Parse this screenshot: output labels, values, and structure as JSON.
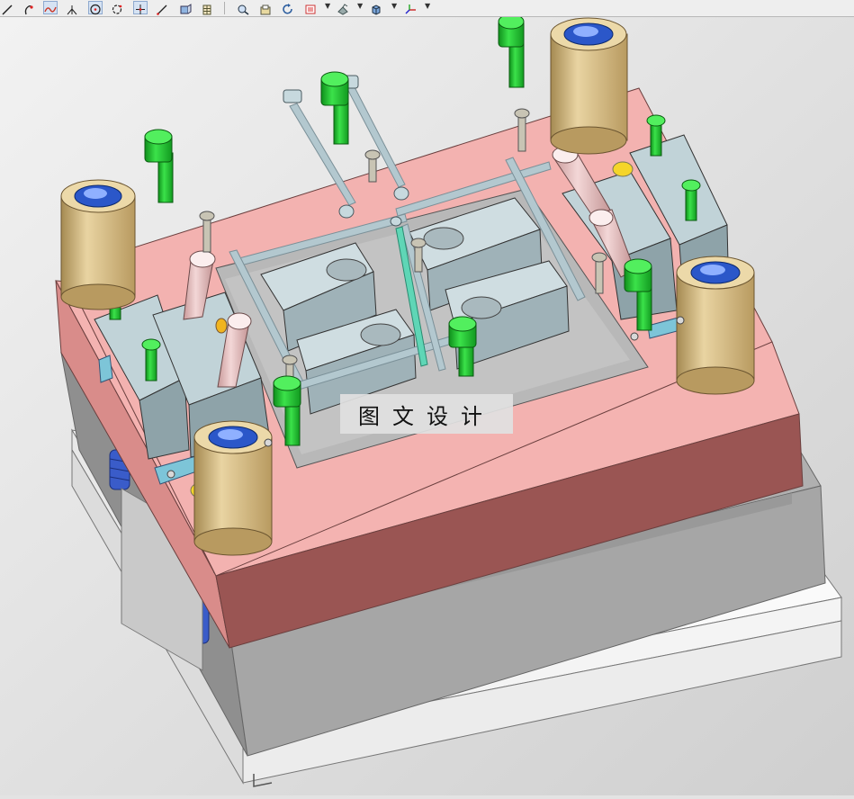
{
  "toolbar": {
    "tools": [
      {
        "name": "line-tool-icon"
      },
      {
        "name": "arc-tool-icon"
      },
      {
        "name": "spline-tool-icon"
      },
      {
        "name": "bisector-tool-icon"
      },
      {
        "name": "circle-center-tool-icon"
      },
      {
        "name": "circle-tool-icon"
      },
      {
        "name": "point-tool-icon"
      },
      {
        "name": "diagonal-line-tool-icon"
      },
      {
        "name": "view-orient-icon"
      },
      {
        "name": "grid-icon"
      },
      {
        "name": "zoom-fit-icon"
      },
      {
        "name": "open-view-icon"
      },
      {
        "name": "rotate-icon"
      },
      {
        "name": "display-mode-icon"
      },
      {
        "name": "render-style-icon"
      },
      {
        "name": "shaded-cube-icon"
      },
      {
        "name": "view-triad-icon"
      }
    ]
  },
  "viewport": {
    "watermark": "图文设计",
    "colors": {
      "pink_plate": "#f4b3b1",
      "pink_side": "#9a5553",
      "grey_plate": "#a6a6a6",
      "bolt": "#1fcc2f",
      "bushing": "#dbbf8a",
      "slider": "#b8cfd6",
      "cooling_pipe": "#a8c0c8"
    }
  }
}
